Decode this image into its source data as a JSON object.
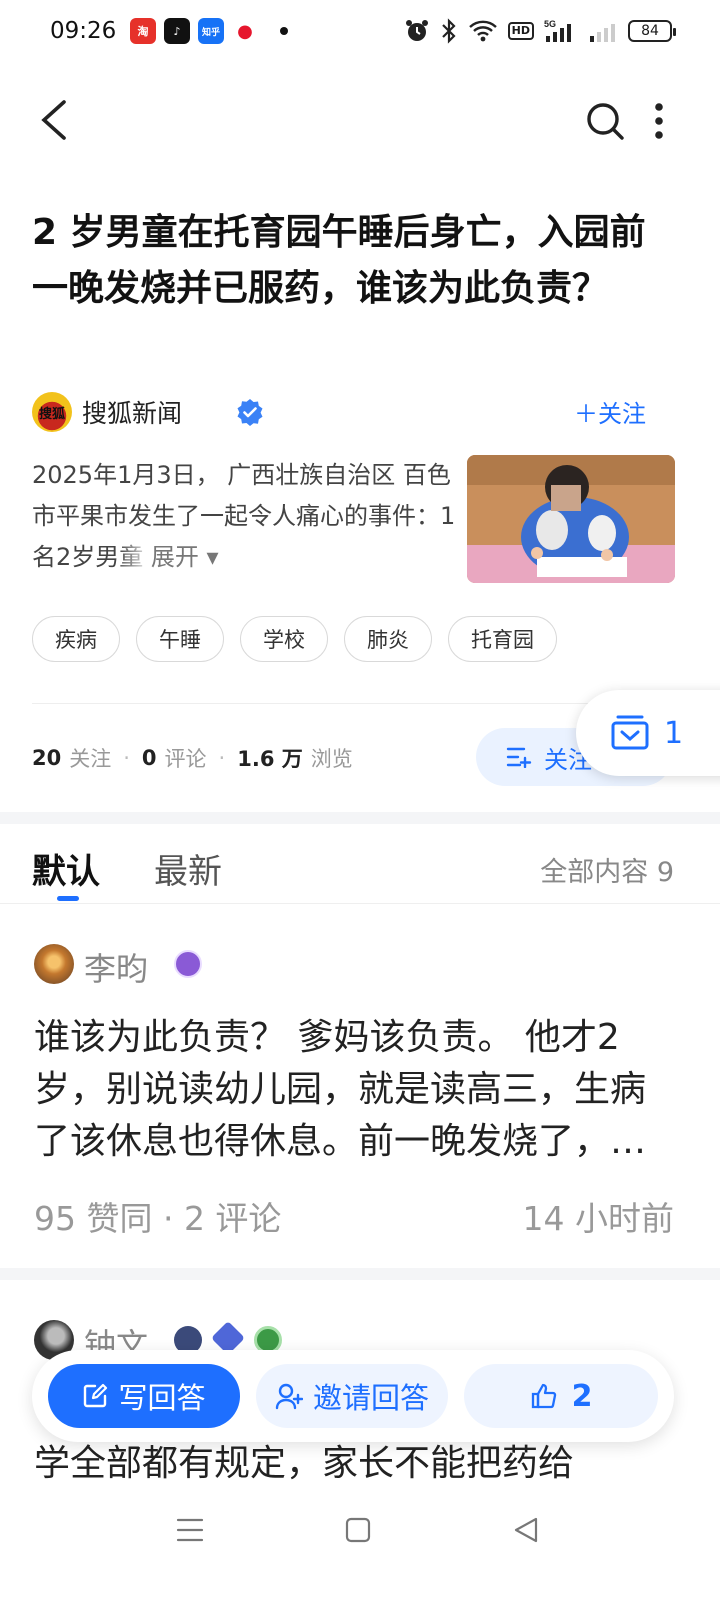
{
  "status_bar": {
    "time": "09:26",
    "apps": [
      {
        "name": "taobao",
        "label": "淘",
        "color": "#e6312a"
      },
      {
        "name": "douyin",
        "label": "♪",
        "color": "#111111"
      },
      {
        "name": "zhihu",
        "label": "知乎",
        "color": "#1772f6"
      },
      {
        "name": "weibo",
        "label": "●",
        "color": "#e6162d"
      }
    ],
    "network": "5G",
    "hd": "HD",
    "battery": "84"
  },
  "top_bar": {
    "back_icon": "chevron-left-icon",
    "search_icon": "search-icon",
    "more_icon": "more-vertical-icon"
  },
  "question": {
    "title": "2 岁男童在托育园午睡后身亡，入园前一晚发烧并已服药，谁该为此负责？",
    "author": "搜狐新闻",
    "author_avatar_text": "搜狐",
    "follow_author": "＋关注",
    "summary_text": "2025年1月3日， 广西壮族自治区 百色市平果市发生了一起令人痛心的事件：1名2岁男",
    "summary_fade": "童",
    "expand_label": "展开 ▾",
    "tags": [
      "疾病",
      "午睡",
      "学校",
      "肺炎",
      "托育园"
    ],
    "stats": {
      "follow_count": "20",
      "follow_label": "关注",
      "comment_count": "0",
      "comment_label": "评论",
      "view_count": "1.6 万",
      "view_label": "浏览"
    },
    "follow_question_label": "关注",
    "floating_count": "1"
  },
  "tabs": {
    "default": "默认",
    "latest": "最新",
    "all_content": "全部内容 9"
  },
  "answers": [
    {
      "author": "李昀",
      "text": "谁该为此负责？ 爹妈该负责。 他才2岁，别说读幼儿园，就是读高三，生病了该休息也得休息。前一晚发烧了，第二天还送去托育园……",
      "meta": "95 赞同 · 2 评论",
      "time": "14 小时前"
    },
    {
      "author": "钟文",
      "text": "学全部都有规定，家长不能把药给"
    }
  ],
  "action_bar": {
    "write_label": "写回答",
    "invite_label": "邀请回答",
    "agree_count": "2"
  },
  "colors": {
    "accent": "#1e6fff",
    "accent_light": "#eef4ff"
  }
}
